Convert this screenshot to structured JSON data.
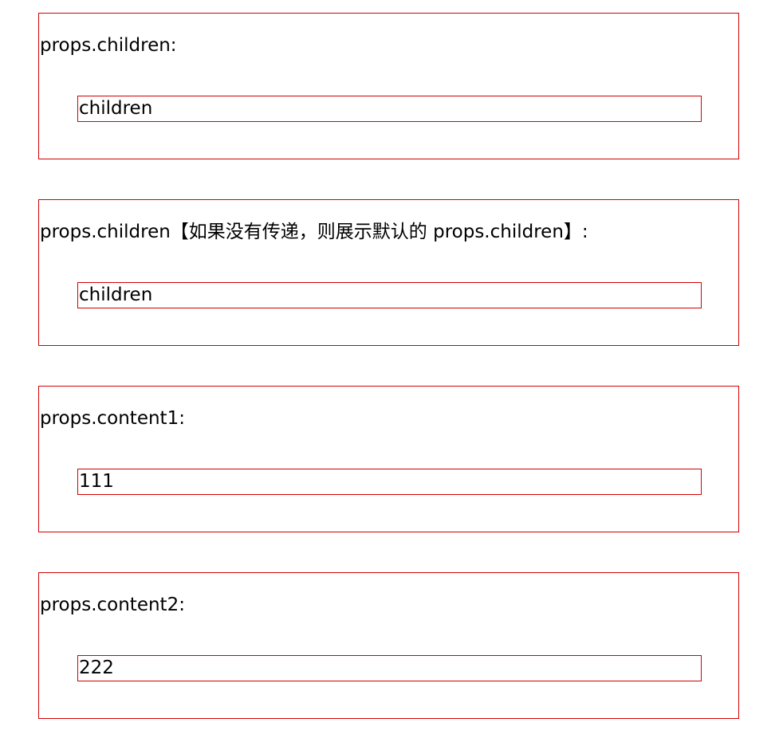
{
  "sections": [
    {
      "label": "props.children:",
      "content": "children"
    },
    {
      "label": "props.children【如果没有传递，则展示默认的 props.children】:",
      "content": "children"
    },
    {
      "label": "props.content1:",
      "content": "111"
    },
    {
      "label": "props.content2:",
      "content": "222"
    }
  ],
  "colors": {
    "border": "#d40000",
    "text": "#000000",
    "background": "#ffffff"
  }
}
